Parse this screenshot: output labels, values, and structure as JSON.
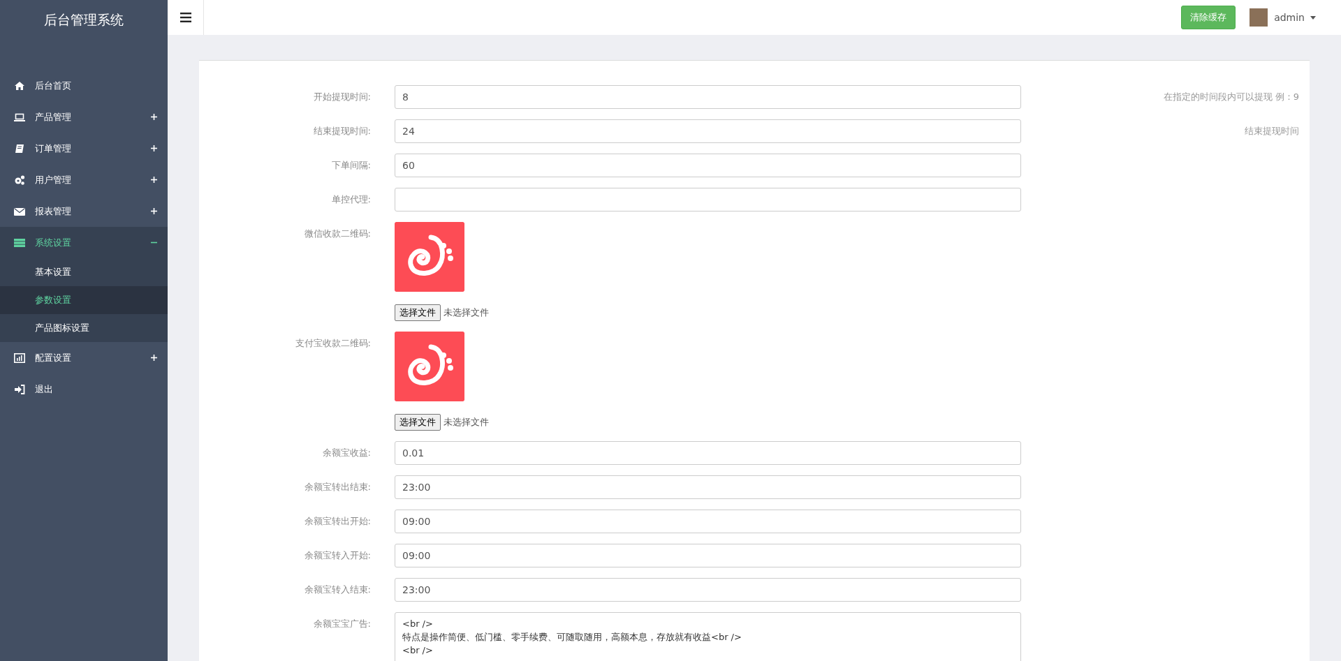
{
  "sidebar": {
    "title": "后台管理系统",
    "items": [
      {
        "kind": "link",
        "label": "后台首页",
        "selected": false
      },
      {
        "kind": "group",
        "label": "产品管理",
        "expanded": false
      },
      {
        "kind": "group",
        "label": "订单管理",
        "expanded": false
      },
      {
        "kind": "group",
        "label": "用户管理",
        "expanded": false
      },
      {
        "kind": "group",
        "label": "报表管理",
        "expanded": false
      },
      {
        "kind": "group",
        "label": "系统设置",
        "expanded": true,
        "children": [
          {
            "label": "基本设置",
            "selected": false
          },
          {
            "label": "参数设置",
            "selected": true
          },
          {
            "label": "产品图标设置",
            "selected": false
          }
        ]
      },
      {
        "kind": "group",
        "label": "配置设置",
        "expanded": false
      },
      {
        "kind": "link",
        "label": "退出",
        "selected": false
      }
    ]
  },
  "header": {
    "clear_cache_button": "清除缓存",
    "user": "admin"
  },
  "form": {
    "fields": [
      {
        "kind": "text",
        "label": "开始提现时间:",
        "value": "8",
        "hint": "在指定的时间段内可以提现 例：9"
      },
      {
        "kind": "text",
        "label": "结束提现时间:",
        "value": "24",
        "hint": "结束提现时间"
      },
      {
        "kind": "text",
        "label": "下单间隔:",
        "value": "60"
      },
      {
        "kind": "text",
        "label": "单控代理:"
      },
      {
        "kind": "image",
        "label": "微信收款二维码:",
        "file_button": "选择文件",
        "file_status": "未选择文件"
      },
      {
        "kind": "image",
        "label": "支付宝收款二维码:",
        "file_button": "选择文件",
        "file_status": "未选择文件"
      },
      {
        "kind": "text",
        "label": "余额宝收益:",
        "value": "0.01"
      },
      {
        "kind": "text",
        "label": "余额宝转出结束:",
        "value": "23:00"
      },
      {
        "kind": "text",
        "label": "余额宝转出开始:",
        "value": "09:00"
      },
      {
        "kind": "text",
        "label": "余额宝转入开始:",
        "value": "09:00"
      },
      {
        "kind": "text",
        "label": "余额宝转入结束:",
        "value": "23:00"
      },
      {
        "kind": "textarea",
        "label": "余额宝宝广告:",
        "lines": [
          "<br />",
          "特点是操作简便、低门槛、零手续费、可随取随用，高额本息，存放就有收益<br />",
          "<br />"
        ]
      }
    ]
  }
}
